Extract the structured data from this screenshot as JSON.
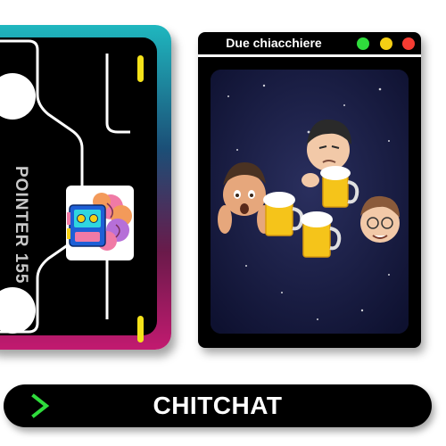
{
  "cassette_card": {
    "label": "POINTER 155",
    "icon": "cassette-brain-icon",
    "gradient_colors": [
      "#1fb7bf",
      "#1b4f77",
      "#6a1a4a",
      "#c21a70"
    ],
    "accent_color": "#f4e21a"
  },
  "window": {
    "title": "Due chiacchiere",
    "controls": [
      {
        "name": "green",
        "color": "#2fdc3c"
      },
      {
        "name": "yellow",
        "color": "#f5cf14"
      },
      {
        "name": "red",
        "color": "#f53c32"
      }
    ],
    "image": "memoji-friends-beer-illustration"
  },
  "bottom_bar": {
    "label": "CHITCHAT",
    "icon": "chevron-right-icon",
    "icon_color": "#2fdc3c"
  }
}
